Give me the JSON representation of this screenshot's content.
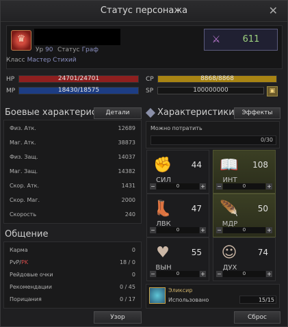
{
  "window": {
    "title": "Статус персонажа"
  },
  "header": {
    "avatar_glyph": "♛",
    "name": "",
    "level_key": "Ур",
    "level": "90",
    "status_key": "Статус",
    "status": "Граф",
    "power": "611",
    "power_icon": "gear-badge-icon",
    "class_key": "Класс",
    "class": "Мастер Стихий"
  },
  "bars": {
    "hp": {
      "label": "HP",
      "text": "24701/24701",
      "cur": 24701,
      "max": 24701,
      "color": "#8e1f1f"
    },
    "mp": {
      "label": "MP",
      "text": "18430/18575",
      "cur": 18430,
      "max": 18575,
      "color": "#1d3d84"
    },
    "cp": {
      "label": "CP",
      "text": "8868/8868",
      "cur": 8868,
      "max": 8868,
      "color": "#a88414"
    },
    "sp": {
      "label": "SP",
      "text": "100000000"
    }
  },
  "combat": {
    "title": "Боевые характеристики",
    "details_label": "Детали",
    "rows": [
      {
        "label": "Физ. Атк.",
        "value": "12689"
      },
      {
        "label": "Маг. Атк.",
        "value": "38873"
      },
      {
        "label": "Физ. Защ.",
        "value": "14037"
      },
      {
        "label": "Маг. Защ.",
        "value": "14382"
      },
      {
        "label": "Скор. Атк.",
        "value": "1431"
      },
      {
        "label": "Скор. Маг.",
        "value": "2000"
      },
      {
        "label": "Скорость",
        "value": "240"
      }
    ]
  },
  "social": {
    "title": "Общение",
    "rows": [
      {
        "label": "Карма",
        "value": "0"
      },
      {
        "label": "PvP/",
        "label_pk": "PK",
        "value": "18 / 0"
      },
      {
        "label": "Рейдовые очки",
        "value": "0"
      },
      {
        "label": "Рекомендации",
        "value": "0 / 45"
      },
      {
        "label": "Порицания",
        "value": "0 / 17"
      }
    ],
    "view_label": "Узор"
  },
  "attributes": {
    "title": "Характеристики",
    "effects_label": "Эффекты",
    "spend_label": "Можно потратить",
    "spend_value": "0/30",
    "stats": [
      {
        "name": "СИЛ",
        "value": "44",
        "input": "0",
        "icon": "fist-icon"
      },
      {
        "name": "ИНТ",
        "value": "108",
        "input": "0",
        "icon": "book-icon"
      },
      {
        "name": "ЛВК",
        "value": "47",
        "input": "0",
        "icon": "boot-icon"
      },
      {
        "name": "МДР",
        "value": "50",
        "input": "0",
        "icon": "feather-icon"
      },
      {
        "name": "ВЫН",
        "value": "55",
        "input": "0",
        "icon": "heart-icon"
      },
      {
        "name": "ДУХ",
        "value": "74",
        "input": "0",
        "icon": "mask-icon"
      }
    ],
    "elixir_label": "Эликсир",
    "elixir_used_label": "Использовано",
    "elixir_value": "15/15",
    "reset_label": "Сброс"
  }
}
